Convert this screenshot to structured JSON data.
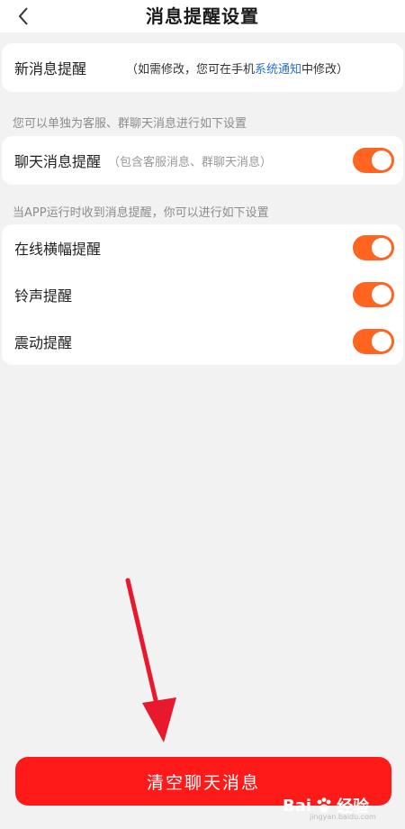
{
  "header": {
    "title": "消息提醒设置"
  },
  "new_message": {
    "label": "新消息提醒",
    "desc_prefix": "（如需修改，您可在手机",
    "desc_link": "系统通知",
    "desc_suffix": "中修改）"
  },
  "section1_hint": "您可以单独为客服、群聊天消息进行如下设置",
  "chat_reminder": {
    "label": "聊天消息提醒",
    "desc": "（包含客服消息、群聊天消息）",
    "enabled": true
  },
  "section2_hint": "当APP运行时收到消息提醒，你可以进行如下设置",
  "in_app_settings": [
    {
      "label": "在线横幅提醒",
      "enabled": true
    },
    {
      "label": "铃声提醒",
      "enabled": true
    },
    {
      "label": "震动提醒",
      "enabled": true
    }
  ],
  "clear_button": {
    "label": "清空聊天消息"
  },
  "watermark": {
    "brand": "Bai",
    "brand2": "经验",
    "sub": "jingyan.baidu.com"
  },
  "colors": {
    "toggle_on": "#ff6420",
    "button": "#ff1a1a",
    "link": "#2a6fd6",
    "arrow": "#e8192c"
  }
}
